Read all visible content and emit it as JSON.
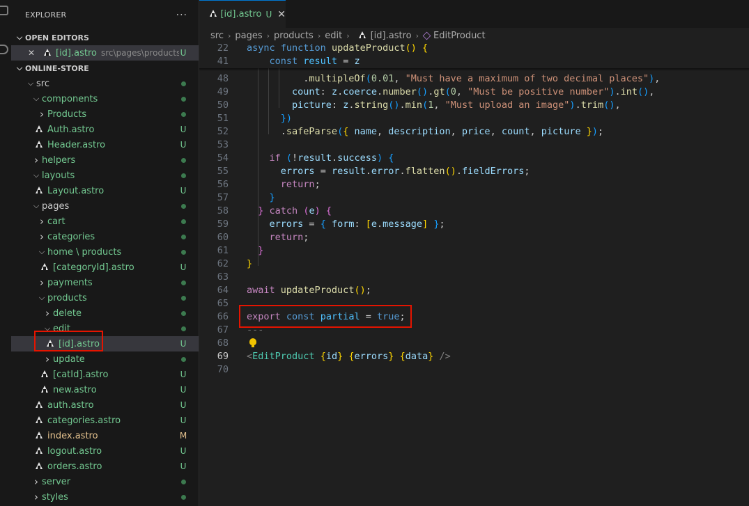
{
  "explorer": {
    "title": "EXPLORER",
    "more": "···",
    "open_editors_label": "OPEN EDITORS",
    "open_editor": {
      "name": "[id].astro",
      "path": "src\\pages\\products\\...",
      "status": "U"
    },
    "project_label": "ONLINE-STORE",
    "tree": [
      {
        "label": "src",
        "type": "folder",
        "open": true,
        "status": "dot",
        "color": "#cccccc"
      },
      {
        "label": "components",
        "type": "folder",
        "open": true,
        "status": "dot",
        "color": "#73c991"
      },
      {
        "label": "Products",
        "type": "folder",
        "open": false,
        "status": "dot",
        "color": "#73c991"
      },
      {
        "label": "Auth.astro",
        "type": "file",
        "status": "U",
        "color": "#73c991"
      },
      {
        "label": "Header.astro",
        "type": "file",
        "status": "U",
        "color": "#73c991"
      },
      {
        "label": "helpers",
        "type": "folder",
        "open": false,
        "status": "dot",
        "color": "#73c991"
      },
      {
        "label": "layouts",
        "type": "folder",
        "open": true,
        "status": "dot",
        "color": "#73c991"
      },
      {
        "label": "Layout.astro",
        "type": "file",
        "status": "U",
        "color": "#73c991"
      },
      {
        "label": "pages",
        "type": "folder",
        "open": true,
        "status": "dot",
        "color": "#cccccc"
      },
      {
        "label": "cart",
        "type": "folder",
        "open": false,
        "status": "dot",
        "color": "#73c991"
      },
      {
        "label": "categories",
        "type": "folder",
        "open": false,
        "status": "dot",
        "color": "#73c991"
      },
      {
        "label": "home \\ products",
        "type": "folder",
        "open": true,
        "status": "dot",
        "color": "#73c991"
      },
      {
        "label": "[categoryId].astro",
        "type": "file",
        "status": "U",
        "color": "#73c991"
      },
      {
        "label": "payments",
        "type": "folder",
        "open": false,
        "status": "dot",
        "color": "#73c991"
      },
      {
        "label": "products",
        "type": "folder",
        "open": true,
        "status": "dot",
        "color": "#73c991"
      },
      {
        "label": "delete",
        "type": "folder",
        "open": false,
        "status": "dot",
        "color": "#73c991"
      },
      {
        "label": "edit",
        "type": "folder",
        "open": true,
        "status": "dot",
        "color": "#73c991"
      },
      {
        "label": "[id].astro",
        "type": "file",
        "status": "U",
        "color": "#73c991"
      },
      {
        "label": "update",
        "type": "folder",
        "open": false,
        "status": "dot",
        "color": "#73c991"
      },
      {
        "label": "[catId].astro",
        "type": "file",
        "status": "U",
        "color": "#73c991"
      },
      {
        "label": "new.astro",
        "type": "file",
        "status": "U",
        "color": "#73c991"
      },
      {
        "label": "auth.astro",
        "type": "file",
        "status": "U",
        "color": "#73c991"
      },
      {
        "label": "categories.astro",
        "type": "file",
        "status": "U",
        "color": "#73c991"
      },
      {
        "label": "index.astro",
        "type": "file",
        "status": "M",
        "color": "#e2c08d"
      },
      {
        "label": "logout.astro",
        "type": "file",
        "status": "U",
        "color": "#73c991"
      },
      {
        "label": "orders.astro",
        "type": "file",
        "status": "U",
        "color": "#73c991"
      },
      {
        "label": "server",
        "type": "folder",
        "open": false,
        "status": "dot",
        "color": "#73c991"
      },
      {
        "label": "styles",
        "type": "folder",
        "open": false,
        "status": "dot",
        "color": "#73c991"
      }
    ]
  },
  "editor": {
    "tab": {
      "name": "[id].astro",
      "status": "U",
      "close": "✕"
    },
    "breadcrumbs": [
      "src",
      "pages",
      "products",
      "edit",
      "[id].astro",
      "EditProduct"
    ],
    "sticky_lines": [
      {
        "num": "22",
        "tokens": [
          [
            "k",
            "async "
          ],
          [
            "k",
            "function "
          ],
          [
            "fn",
            "updateProduct"
          ],
          [
            "p1",
            "() {"
          ]
        ]
      },
      {
        "num": "41",
        "tokens": [
          [
            "",
            "    "
          ],
          [
            "k",
            "const "
          ],
          [
            "cst",
            "result"
          ],
          [
            "",
            " = "
          ],
          [
            "v",
            "z"
          ]
        ]
      }
    ],
    "lines": [
      {
        "num": "48",
        "tokens": [
          [
            "",
            "          ."
          ],
          [
            "fn",
            "multipleOf"
          ],
          [
            "p3",
            "("
          ],
          [
            "n",
            "0.01"
          ],
          [
            "",
            ", "
          ],
          [
            "s",
            "\"Must have a maximum of two decimal places\""
          ],
          [
            "p3",
            ")"
          ],
          [
            "",
            ","
          ]
        ]
      },
      {
        "num": "49",
        "tokens": [
          [
            "",
            "        "
          ],
          [
            "v",
            "count"
          ],
          [
            "",
            ": "
          ],
          [
            "v",
            "z"
          ],
          [
            "",
            "."
          ],
          [
            "v",
            "coerce"
          ],
          [
            "",
            "."
          ],
          [
            "fn",
            "number"
          ],
          [
            "p3",
            "()"
          ],
          [
            "",
            "."
          ],
          [
            "fn",
            "gt"
          ],
          [
            "p3",
            "("
          ],
          [
            "n",
            "0"
          ],
          [
            "",
            ", "
          ],
          [
            "s",
            "\"Must be positive number\""
          ],
          [
            "p3",
            ")"
          ],
          [
            "",
            "."
          ],
          [
            "fn",
            "int"
          ],
          [
            "p3",
            "()"
          ],
          [
            "",
            ","
          ]
        ]
      },
      {
        "num": "50",
        "tokens": [
          [
            "",
            "        "
          ],
          [
            "v",
            "picture"
          ],
          [
            "",
            ": "
          ],
          [
            "v",
            "z"
          ],
          [
            "",
            "."
          ],
          [
            "fn",
            "string"
          ],
          [
            "p3",
            "()"
          ],
          [
            "",
            "."
          ],
          [
            "fn",
            "min"
          ],
          [
            "p3",
            "("
          ],
          [
            "n",
            "1"
          ],
          [
            "",
            ", "
          ],
          [
            "s",
            "\"Must upload an image\""
          ],
          [
            "p3",
            ")"
          ],
          [
            "",
            "."
          ],
          [
            "fn",
            "trim"
          ],
          [
            "p3",
            "()"
          ],
          [
            "",
            ","
          ]
        ]
      },
      {
        "num": "51",
        "tokens": [
          [
            "",
            "      "
          ],
          [
            "p3",
            "})"
          ]
        ]
      },
      {
        "num": "52",
        "tokens": [
          [
            "",
            "      ."
          ],
          [
            "fn",
            "safeParse"
          ],
          [
            "p3",
            "("
          ],
          [
            "p1",
            "{ "
          ],
          [
            "v",
            "name"
          ],
          [
            "",
            ", "
          ],
          [
            "v",
            "description"
          ],
          [
            "",
            ", "
          ],
          [
            "v",
            "price"
          ],
          [
            "",
            ", "
          ],
          [
            "v",
            "count"
          ],
          [
            "",
            ", "
          ],
          [
            "v",
            "picture"
          ],
          [
            "p1",
            " }"
          ],
          [
            "p3",
            ")"
          ],
          [
            "",
            ";"
          ]
        ]
      },
      {
        "num": "53",
        "tokens": []
      },
      {
        "num": "54",
        "tokens": [
          [
            "",
            "    "
          ],
          [
            "kc",
            "if "
          ],
          [
            "p3",
            "("
          ],
          [
            "",
            "!"
          ],
          [
            "v",
            "result"
          ],
          [
            "",
            "."
          ],
          [
            "v",
            "success"
          ],
          [
            "p3",
            ")"
          ],
          [
            "p3",
            " {"
          ]
        ]
      },
      {
        "num": "55",
        "tokens": [
          [
            "",
            "      "
          ],
          [
            "v",
            "errors"
          ],
          [
            "",
            " = "
          ],
          [
            "v",
            "result"
          ],
          [
            "",
            "."
          ],
          [
            "v",
            "error"
          ],
          [
            "",
            "."
          ],
          [
            "fn",
            "flatten"
          ],
          [
            "p1",
            "()"
          ],
          [
            "",
            "."
          ],
          [
            "v",
            "fieldErrors"
          ],
          [
            "",
            ";"
          ]
        ]
      },
      {
        "num": "56",
        "tokens": [
          [
            "",
            "      "
          ],
          [
            "kc",
            "return"
          ],
          [
            "",
            ";"
          ]
        ]
      },
      {
        "num": "57",
        "tokens": [
          [
            "",
            "    "
          ],
          [
            "p3",
            "}"
          ]
        ]
      },
      {
        "num": "58",
        "tokens": [
          [
            "",
            "  "
          ],
          [
            "p2",
            "} "
          ],
          [
            "kc",
            "catch "
          ],
          [
            "p2",
            "("
          ],
          [
            "v",
            "e"
          ],
          [
            "p2",
            ") {"
          ]
        ]
      },
      {
        "num": "59",
        "tokens": [
          [
            "",
            "    "
          ],
          [
            "v",
            "errors"
          ],
          [
            "",
            " = "
          ],
          [
            "p3",
            "{ "
          ],
          [
            "v",
            "form"
          ],
          [
            "",
            ": "
          ],
          [
            "p1",
            "["
          ],
          [
            "v",
            "e"
          ],
          [
            "",
            "."
          ],
          [
            "v",
            "message"
          ],
          [
            "p1",
            "]"
          ],
          [
            "p3",
            " }"
          ],
          [
            "",
            ";"
          ]
        ]
      },
      {
        "num": "60",
        "tokens": [
          [
            "",
            "    "
          ],
          [
            "kc",
            "return"
          ],
          [
            "",
            ";"
          ]
        ]
      },
      {
        "num": "61",
        "tokens": [
          [
            "",
            "  "
          ],
          [
            "p2",
            "}"
          ]
        ]
      },
      {
        "num": "62",
        "tokens": [
          [
            "p1",
            "}"
          ]
        ]
      },
      {
        "num": "63",
        "tokens": []
      },
      {
        "num": "64",
        "tokens": [
          [
            "kc",
            "await "
          ],
          [
            "fn",
            "updateProduct"
          ],
          [
            "p1",
            "()"
          ],
          [
            "",
            ";"
          ]
        ]
      },
      {
        "num": "65",
        "tokens": []
      },
      {
        "num": "66",
        "tokens": [
          [
            "kc",
            "export "
          ],
          [
            "k",
            "const "
          ],
          [
            "cst",
            "partial"
          ],
          [
            "",
            " = "
          ],
          [
            "k",
            "true"
          ],
          [
            "",
            ";"
          ]
        ]
      },
      {
        "num": "67",
        "tokens": [
          [
            "dim",
            "---"
          ]
        ]
      },
      {
        "num": "68",
        "tokens": []
      },
      {
        "num": "69",
        "tokens": [
          [
            "tg",
            "<"
          ],
          [
            "ty",
            "EditProduct"
          ],
          [
            "",
            " "
          ],
          [
            "p1",
            "{"
          ],
          [
            "v",
            "id"
          ],
          [
            "p1",
            "}"
          ],
          [
            "",
            " "
          ],
          [
            "p1",
            "{"
          ],
          [
            "v",
            "errors"
          ],
          [
            "p1",
            "}"
          ],
          [
            "",
            " "
          ],
          [
            "p1",
            "{"
          ],
          [
            "v",
            "data"
          ],
          [
            "p1",
            "}"
          ],
          [
            "",
            " "
          ],
          [
            "tg",
            "/>"
          ]
        ]
      },
      {
        "num": "70",
        "tokens": []
      }
    ],
    "current_line": "69"
  }
}
